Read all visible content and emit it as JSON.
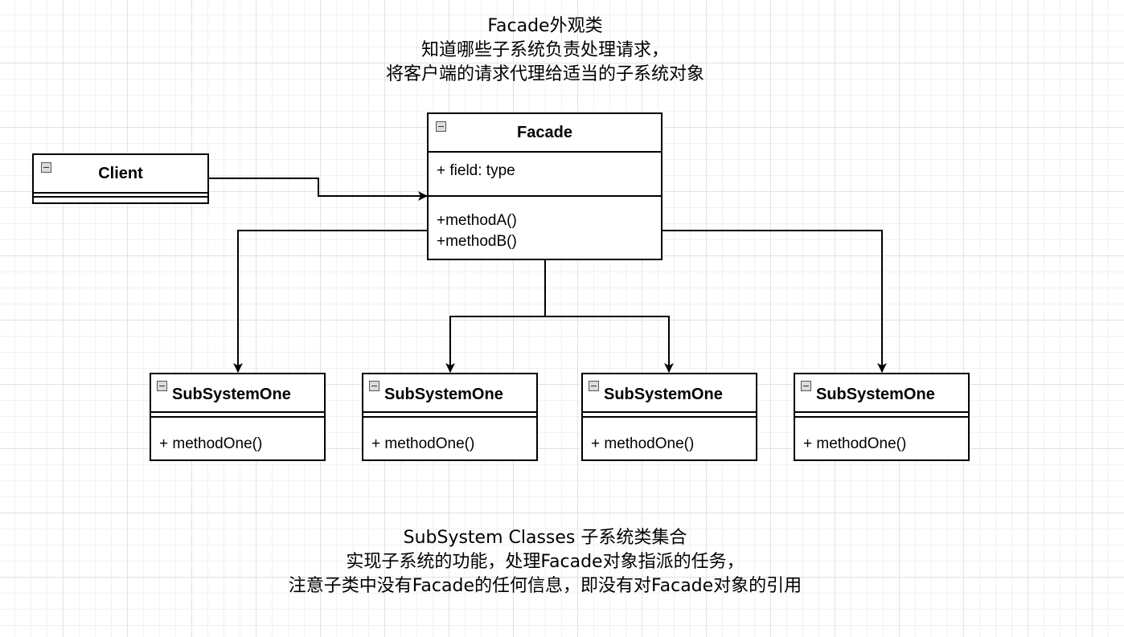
{
  "notes": {
    "top": [
      "Facade外观类",
      "知道哪些子系统负责处理请求，",
      "将客户端的请求代理给适当的子系统对象"
    ],
    "bottom": [
      "SubSystem Classes 子系统类集合",
      "实现子系统的功能，处理Facade对象指派的任务，",
      "注意子类中没有Facade的任何信息，即没有对Facade对象的引用"
    ]
  },
  "classes": {
    "client": {
      "name": "Client"
    },
    "facade": {
      "name": "Facade",
      "fields": [
        "+ field: type"
      ],
      "methods": [
        "+methodA()",
        "+methodB()"
      ]
    },
    "subsystems": [
      {
        "name": "SubSystemOne",
        "methods": [
          "+ methodOne()"
        ]
      },
      {
        "name": "SubSystemOne",
        "methods": [
          "+ methodOne()"
        ]
      },
      {
        "name": "SubSystemOne",
        "methods": [
          "+ methodOne()"
        ]
      },
      {
        "name": "SubSystemOne",
        "methods": [
          "+ methodOne()"
        ]
      }
    ]
  },
  "colors": {
    "line": "#000000",
    "grid_major": "#e2e2e2",
    "grid_minor": "#f1f1f1",
    "collapse_icon_fill": "#dcdcdc"
  },
  "icons": [
    "collapse-icon"
  ]
}
